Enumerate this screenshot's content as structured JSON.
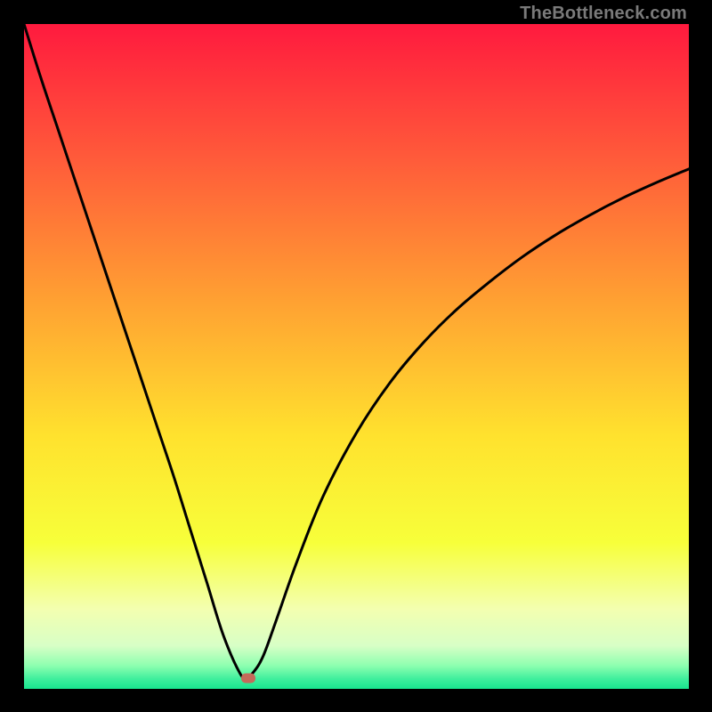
{
  "watermark": "TheBottleneck.com",
  "chart_data": {
    "type": "line",
    "title": "",
    "xlabel": "",
    "ylabel": "",
    "xlim": [
      0,
      100
    ],
    "ylim": [
      0,
      100
    ],
    "gradient_stops": [
      {
        "offset": 0,
        "color": "#ff1a3e"
      },
      {
        "offset": 0.2,
        "color": "#ff5a3a"
      },
      {
        "offset": 0.42,
        "color": "#ffa232"
      },
      {
        "offset": 0.62,
        "color": "#ffe22e"
      },
      {
        "offset": 0.78,
        "color": "#f7ff3a"
      },
      {
        "offset": 0.88,
        "color": "#f3ffb0"
      },
      {
        "offset": 0.935,
        "color": "#d8ffc6"
      },
      {
        "offset": 0.965,
        "color": "#8effb0"
      },
      {
        "offset": 0.985,
        "color": "#3fef9d"
      },
      {
        "offset": 1.0,
        "color": "#18e58f"
      }
    ],
    "series": [
      {
        "name": "bottleneck-curve",
        "x": [
          0,
          2.5,
          5,
          7.5,
          10,
          12.5,
          15,
          17.5,
          20,
          22.5,
          25,
          27.5,
          30,
          32.5,
          33.5,
          34.5,
          36,
          38,
          41,
          45,
          50,
          55,
          60,
          65,
          70,
          75,
          80,
          85,
          90,
          95,
          100
        ],
        "y": [
          100,
          92,
          84.5,
          77,
          69.5,
          62,
          54.5,
          47,
          39.5,
          32,
          24,
          16,
          8,
          2.3,
          1.8,
          2.5,
          5,
          10.5,
          19,
          29,
          38.5,
          46,
          52,
          57,
          61.2,
          65,
          68.3,
          71.2,
          73.8,
          76.1,
          78.2
        ]
      }
    ],
    "marker": {
      "x": 33.8,
      "y": 1.6,
      "color": "#c46a5a"
    }
  }
}
